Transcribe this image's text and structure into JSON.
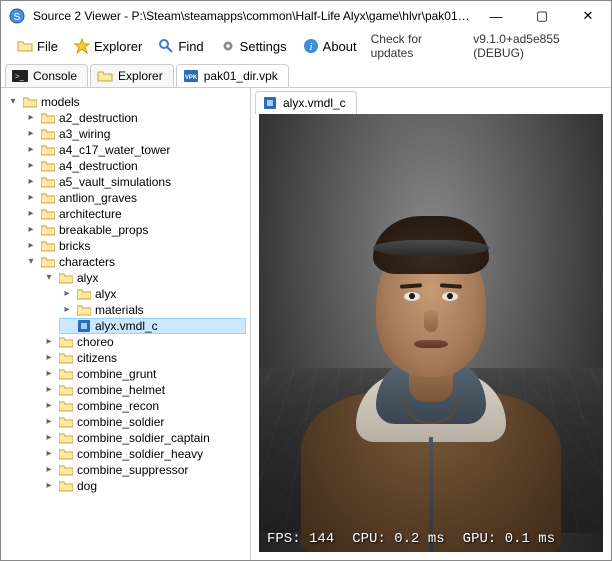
{
  "window": {
    "title": "Source 2 Viewer - P:\\Steam\\steamapps\\common\\Half-Life Alyx\\game\\hlvr\\pak01_..."
  },
  "titlebar_buttons": {
    "minimize": "—",
    "maximize": "▢",
    "close": "✕"
  },
  "toolbar": {
    "file": "File",
    "explorer": "Explorer",
    "find": "Find",
    "settings": "Settings",
    "about": "About",
    "check_updates": "Check for updates",
    "version": "v9.1.0+ad5e855 (DEBUG)"
  },
  "main_tabs": {
    "console": "Console",
    "explorer": "Explorer",
    "vpk": "pak01_dir.vpk"
  },
  "viewer_tabs": {
    "model": "alyx.vmdl_c"
  },
  "tree": {
    "root": "models",
    "items": [
      {
        "label": "a2_destruction"
      },
      {
        "label": "a3_wiring"
      },
      {
        "label": "a4_c17_water_tower"
      },
      {
        "label": "a4_destruction"
      },
      {
        "label": "a5_vault_simulations"
      },
      {
        "label": "antlion_graves"
      },
      {
        "label": "architecture"
      },
      {
        "label": "breakable_props"
      },
      {
        "label": "bricks"
      }
    ],
    "characters": {
      "label": "characters",
      "alyx": {
        "label": "alyx",
        "children": [
          {
            "label": "alyx",
            "type": "folder"
          },
          {
            "label": "materials",
            "type": "folder"
          },
          {
            "label": "alyx.vmdl_c",
            "type": "file"
          }
        ]
      },
      "rest": [
        {
          "label": "choreo"
        },
        {
          "label": "citizens"
        },
        {
          "label": "combine_grunt"
        },
        {
          "label": "combine_helmet"
        },
        {
          "label": "combine_recon"
        },
        {
          "label": "combine_soldier"
        },
        {
          "label": "combine_soldier_captain"
        },
        {
          "label": "combine_soldier_heavy"
        },
        {
          "label": "combine_suppressor"
        },
        {
          "label": "dog"
        }
      ]
    }
  },
  "viewport_stats": {
    "fps_label": "FPS:",
    "fps_value": "144",
    "cpu_label": "CPU:",
    "cpu_value": "0.2 ms",
    "gpu_label": "GPU:",
    "gpu_value": "0.1 ms"
  }
}
